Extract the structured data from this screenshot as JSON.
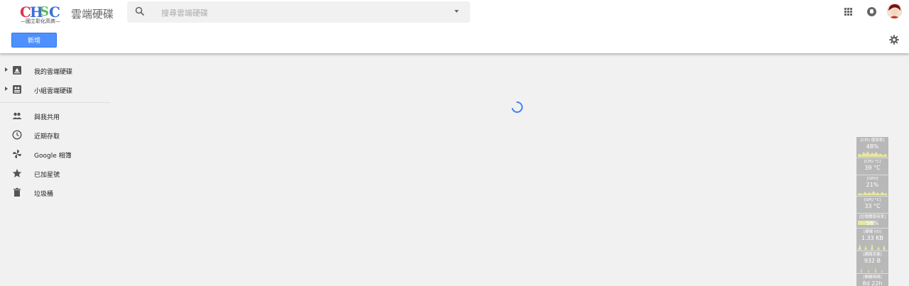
{
  "header": {
    "logo_text": "CHSC",
    "logo_subtitle": "—國立彰化高商—",
    "app_title": "雲端硬碟",
    "search_placeholder": "搜尋雲端硬碟",
    "icons": [
      "search-icon",
      "chevron-down-icon",
      "apps-grid-icon",
      "notifications-icon",
      "avatar"
    ]
  },
  "toolbar": {
    "new_label": "新增",
    "settings_icon": "gear-icon"
  },
  "sidebar": {
    "items": [
      {
        "label": "我的雲端硬碟",
        "icon": "drive-icon",
        "expandable": true
      },
      {
        "label": "小組雲端硬碟",
        "icon": "team-drive-icon",
        "expandable": true
      },
      {
        "label": "與我共用",
        "icon": "people-icon",
        "expandable": false
      },
      {
        "label": "近期存取",
        "icon": "clock-icon",
        "expandable": false
      },
      {
        "label": "Google 相簿",
        "icon": "photos-pinwheel-icon",
        "expandable": false
      },
      {
        "label": "已加星號",
        "icon": "star-icon",
        "expandable": false
      },
      {
        "label": "垃圾桶",
        "icon": "trash-icon",
        "expandable": false
      }
    ]
  },
  "main": {
    "loading_icon": "loading-spinner-icon"
  },
  "system_monitor": {
    "cells": [
      {
        "label": "[CPU 使用率]",
        "value": "48%"
      },
      {
        "label": "[CPU °C]",
        "value": "39 °C"
      },
      {
        "label": "[GPU]",
        "value": "21%"
      },
      {
        "label": "[GPU °C]",
        "value": "33 °C"
      },
      {
        "label": "[記憶體使用率]",
        "value": "56%",
        "level": 0.56
      },
      {
        "label": "[硬碟 I/O]",
        "value": "1.33 KB"
      },
      {
        "label": "[網路流量]",
        "value": "932 B"
      },
      {
        "label": "[開機時間]",
        "value": "8d 22h"
      }
    ]
  },
  "colors": {
    "accent": "#4d90fe",
    "page_bg": "#f1f1f1",
    "monitor_bg": "#b8b8b8",
    "spark": "#e6e6a0"
  }
}
